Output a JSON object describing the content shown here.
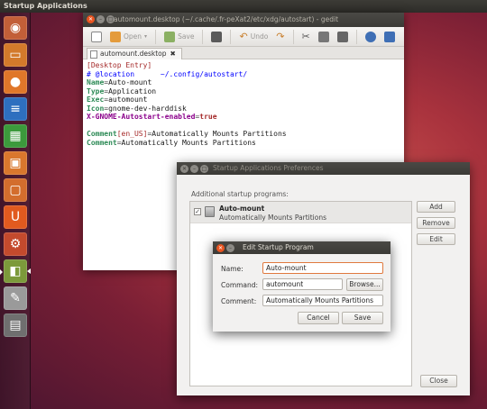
{
  "top_panel": {
    "title": "Startup Applications"
  },
  "launcher": {
    "items": [
      {
        "name": "dash-home",
        "glyph": "◉",
        "color": "#c25f38"
      },
      {
        "name": "files",
        "glyph": "▭",
        "color": "#d37a2b"
      },
      {
        "name": "firefox",
        "glyph": "●",
        "color": "#e0772a"
      },
      {
        "name": "libreoffice-writer",
        "glyph": "≡",
        "color": "#2e6fbf"
      },
      {
        "name": "libreoffice-calc",
        "glyph": "▦",
        "color": "#3c9a3c"
      },
      {
        "name": "libreoffice-impress",
        "glyph": "▣",
        "color": "#d9772d"
      },
      {
        "name": "software-center",
        "glyph": "▢",
        "color": "#d36d2d"
      },
      {
        "name": "ubuntu-one",
        "glyph": "U",
        "color": "#e15a1f"
      },
      {
        "name": "system-settings",
        "glyph": "⚙",
        "color": "#c44a2d"
      },
      {
        "name": "startup-applications",
        "glyph": "◧",
        "color": "#7c9a3b"
      },
      {
        "name": "gedit",
        "glyph": "✎",
        "color": "#9a9a9a"
      },
      {
        "name": "workspace-switcher",
        "glyph": "▤",
        "color": "#6f6f6f"
      }
    ]
  },
  "gedit": {
    "title": "automount.desktop (~/.cache/.fr-peXat2/etc/xdg/autostart) - gedit",
    "toolbar": {
      "open_label": "Open",
      "save_label": "Save",
      "undo_label": "Undo"
    },
    "tab_label": "automount.desktop",
    "editor": {
      "section": "[Desktop Entry]",
      "comment_hash": "#",
      "comment_key": "@location",
      "comment_path": "~/.config/autostart/",
      "lines": [
        {
          "key": "Name",
          "value": "Auto-mount"
        },
        {
          "key": "Type",
          "value": "Application"
        },
        {
          "key": "Exec",
          "value": "automount"
        },
        {
          "key": "Icon",
          "value": "gnome-dev-harddisk"
        }
      ],
      "autostart_key": "X-GNOME-Autostart-enabled",
      "autostart_value": "true",
      "comment_line_1": {
        "key": "Comment",
        "lang": "[en_US]",
        "value": "Automatically Mounts Partitions"
      },
      "comment_line_2": {
        "key": "Comment",
        "value": "Automatically Mounts Partitions"
      }
    }
  },
  "prefs": {
    "title": "Startup Applications Preferences",
    "list_label": "Additional startup programs:",
    "items": [
      {
        "name": "Auto-mount",
        "comment": "Automatically Mounts Partitions"
      }
    ],
    "add_label": "Add",
    "remove_label": "Remove",
    "edit_label": "Edit",
    "close_label": "Close"
  },
  "edit_dialog": {
    "title": "Edit Startup Program",
    "name_label": "Name:",
    "name_value": "Auto-mount",
    "command_label": "Command:",
    "command_value": "automount",
    "browse_label": "Browse...",
    "comment_label": "Comment:",
    "comment_value": "Automatically Mounts Partitions",
    "cancel_label": "Cancel",
    "save_label": "Save"
  }
}
